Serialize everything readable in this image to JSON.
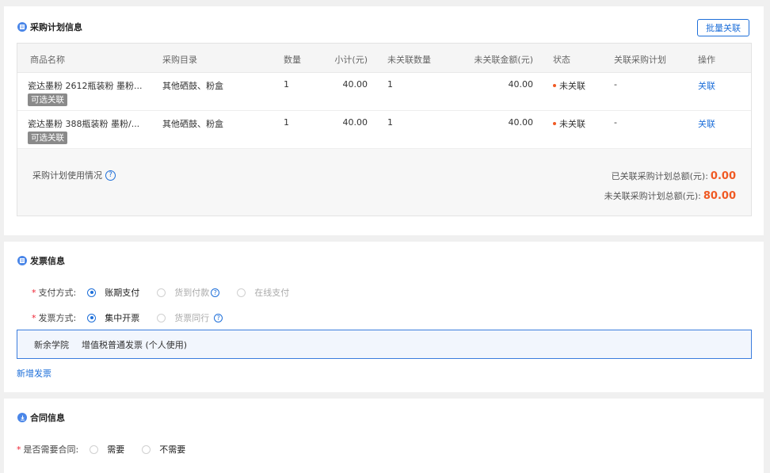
{
  "plan_section": {
    "title": "采购计划信息",
    "batch_button": "批量关联",
    "columns": [
      "商品名称",
      "采购目录",
      "数量",
      "小计(元)",
      "未关联数量",
      "未关联金额(元)",
      "状态",
      "关联采购计划",
      "操作"
    ],
    "rows": [
      {
        "name": "瓷达墨粉 2612瓶装粉 墨粉...",
        "tag": "可选关联",
        "catalog": "其他硒鼓、粉盒",
        "qty": "1",
        "subtotal": "40.00",
        "unlinked_qty": "1",
        "unlinked_amount": "40.00",
        "status": "未关联",
        "linked_plan": "-",
        "action": "关联"
      },
      {
        "name": "瓷达墨粉 388瓶装粉 墨粉/...",
        "tag": "可选关联",
        "catalog": "其他硒鼓、粉盒",
        "qty": "1",
        "subtotal": "40.00",
        "unlinked_qty": "1",
        "unlinked_amount": "40.00",
        "status": "未关联",
        "linked_plan": "-",
        "action": "关联"
      }
    ],
    "usage_label": "采购计划使用情况",
    "linked_total_label": "已关联采购计划总额(元):",
    "linked_total_value": "0.00",
    "unlinked_total_label": "未关联采购计划总额(元):",
    "unlinked_total_value": "80.00"
  },
  "invoice_section": {
    "title": "发票信息",
    "payment_label": "支付方式:",
    "payment_options": [
      "账期支付",
      "货到付款",
      "在线支付"
    ],
    "payment_selected": "账期支付",
    "invoice_method_label": "发票方式:",
    "invoice_method_options": [
      "集中开票",
      "货票同行"
    ],
    "invoice_method_selected": "集中开票",
    "invoice_org": "新余学院",
    "invoice_type": "增值税普通发票 (个人使用)",
    "add_invoice": "新增发票"
  },
  "contract_section": {
    "title": "合同信息",
    "need_contract_label": "是否需要合同:",
    "options": [
      "需要",
      "不需要"
    ]
  },
  "colors": {
    "accent": "#1e6fd9",
    "highlight": "#f05a24",
    "tag_bg": "#8a8a8a",
    "required": "#ee2233"
  }
}
